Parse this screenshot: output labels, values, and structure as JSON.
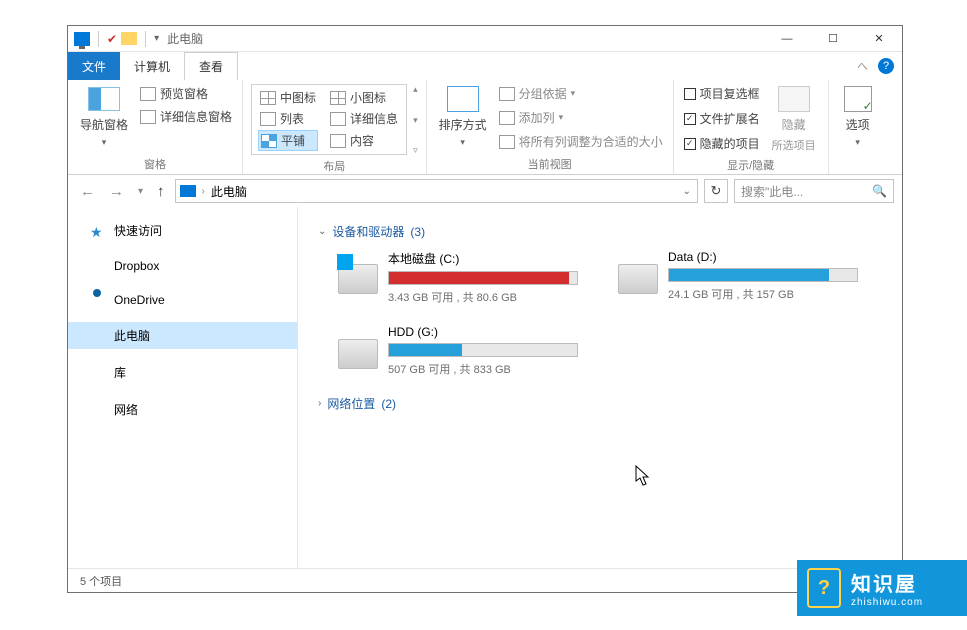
{
  "title": "此电脑",
  "tabs": {
    "file": "文件",
    "computer": "计算机",
    "view": "查看"
  },
  "ribbon": {
    "panes": {
      "nav_pane": "导航窗格",
      "preview_pane": "预览窗格",
      "details_pane": "详细信息窗格",
      "group_label": "窗格"
    },
    "layout": {
      "medium": "中图标",
      "small": "小图标",
      "list": "列表",
      "details": "详细信息",
      "tiles": "平铺",
      "content": "内容",
      "group_label": "布局"
    },
    "current_view": {
      "sort": "排序方式",
      "group_by": "分组依据",
      "add_columns": "添加列",
      "size_all": "将所有列调整为合适的大小",
      "group_label": "当前视图"
    },
    "show_hide": {
      "cb_item": "项目复选框",
      "cb_ext": "文件扩展名",
      "cb_hidden": "隐藏的项目",
      "hide": "隐藏",
      "hide_sub": "所选项目",
      "group_label": "显示/隐藏"
    },
    "options": {
      "label": "选项"
    }
  },
  "address": {
    "location": "此电脑"
  },
  "search": {
    "placeholder": "搜索\"此电..."
  },
  "sidebar": {
    "quick": "快速访问",
    "dropbox": "Dropbox",
    "onedrive": "OneDrive",
    "thispc": "此电脑",
    "libraries": "库",
    "network": "网络"
  },
  "groups": {
    "devices": {
      "label": "设备和驱动器",
      "count": "(3)"
    },
    "network": {
      "label": "网络位置",
      "count": "(2)"
    }
  },
  "drives": [
    {
      "name": "本地磁盘 (C:)",
      "free": "3.43 GB 可用 , 共 80.6 GB",
      "fill_pct": 96,
      "color": "red",
      "win": true
    },
    {
      "name": "Data (D:)",
      "free": "24.1 GB 可用 , 共 157 GB",
      "fill_pct": 85,
      "color": "blue",
      "win": false
    },
    {
      "name": "HDD (G:)",
      "free": "507 GB 可用 , 共 833 GB",
      "fill_pct": 39,
      "color": "blue",
      "win": false
    }
  ],
  "status": {
    "items": "5 个项目"
  },
  "watermark": {
    "big": "知识屋",
    "small": "zhishiwu.com"
  }
}
